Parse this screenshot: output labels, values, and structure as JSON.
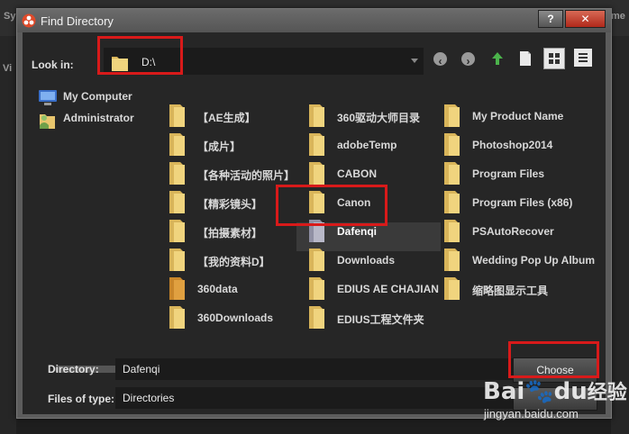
{
  "background": {
    "left_text": "Sy",
    "left_text2": "Vi",
    "right_text": "me"
  },
  "dialog": {
    "title": "Find Directory",
    "help_label": "?",
    "close_label": "✕"
  },
  "look_in": {
    "label": "Look in:",
    "value": "D:\\"
  },
  "sidebar": {
    "items": [
      {
        "label": "My Computer",
        "icon": "computer-icon"
      },
      {
        "label": "Administrator",
        "icon": "user-folder-icon"
      }
    ]
  },
  "files": {
    "col1": [
      "【AE生成】",
      "【成片】",
      "【各种活动的照片】",
      "【精彩镜头】",
      "【拍摄素材】",
      "【我的资料D】",
      "360data",
      "360Downloads"
    ],
    "col2": [
      "360驱动大师目录",
      "adobeTemp",
      "CABON",
      "Canon",
      "Dafenqi",
      "Downloads",
      "EDIUS AE CHAJIAN",
      "EDIUS工程文件夹"
    ],
    "col3": [
      "My Product Name",
      "Photoshop2014",
      "Program Files",
      "Program Files (x86)",
      "PSAutoRecover",
      "Wedding Pop Up Album",
      "缩略图显示工具"
    ]
  },
  "selected": "Dafenqi",
  "directory": {
    "label": "Directory:",
    "value": "Dafenqi"
  },
  "files_of_type": {
    "label": "Files of type:",
    "value": "Directories"
  },
  "buttons": {
    "choose": "Choose"
  },
  "watermark": {
    "brand": "Bai",
    "brand2": "du",
    "suffix": "经验",
    "url": "jingyan.baidu.com"
  },
  "colors": {
    "highlight": "#d81a1a",
    "folder": "#e8c66e"
  }
}
